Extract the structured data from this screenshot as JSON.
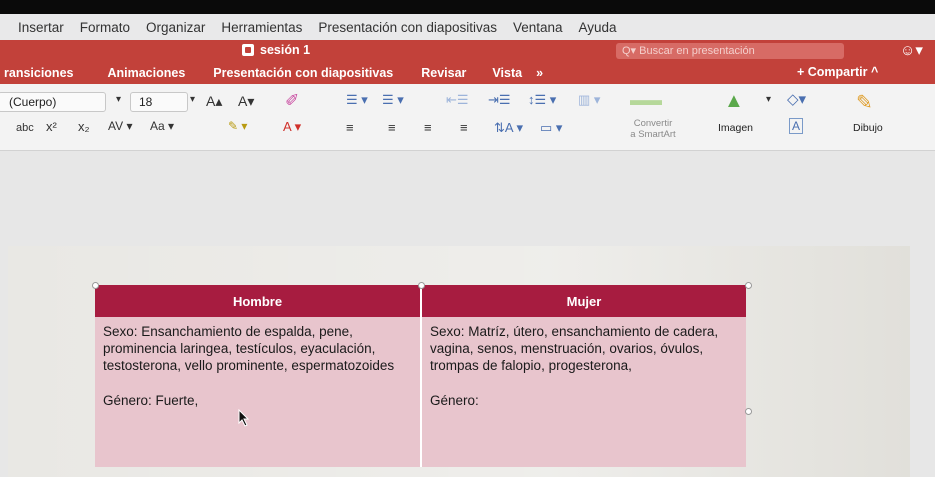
{
  "menubar": [
    "Insertar",
    "Formato",
    "Organizar",
    "Herramientas",
    "Presentación con diapositivas",
    "Ventana",
    "Ayuda"
  ],
  "titlebar": {
    "doc_title": "sesión 1",
    "search_placeholder": "Q▾ Buscar en presentación",
    "account_icon": "☺▾"
  },
  "ribbon_tabs": [
    "ransiciones",
    "Animaciones",
    "Presentación con diapositivas",
    "Revisar",
    "Vista",
    "»"
  ],
  "share_label": "+ Compartir  ^",
  "ribbon": {
    "font_name": "(Cuerpo)",
    "font_size": "18",
    "grow_font": "A▴",
    "shrink_font": "A▾",
    "strikethrough": "abc",
    "superscript": "x²",
    "subscript": "x₂",
    "char_spacing": "AV ▾",
    "change_case": "Aa ▾",
    "highlight": "✎ ▾",
    "font_color": "A ▾",
    "convert_smartart": "Convertir\na SmartArt",
    "image_label": "Imagen",
    "drawing_label": "Dibujo"
  },
  "table": {
    "headers": [
      "Hombre",
      "Mujer"
    ],
    "col1": {
      "sexo": "Sexo: Ensanchamiento de espalda, pene, prominencia laringea, testículos, eyaculación, testosterona, vello prominente, espermatozoides",
      "genero": "Género: Fuerte,"
    },
    "col2": {
      "sexo": "Sexo: Matríz, útero, ensanchamiento de cadera, vagina, senos, menstruación, ovarios, óvulos, trompas de falopio, progesterona,",
      "genero": "Género:"
    }
  },
  "colors": {
    "brand_red": "#c2413a",
    "table_header": "#a71c40",
    "table_cell": "#e8c5cd"
  }
}
